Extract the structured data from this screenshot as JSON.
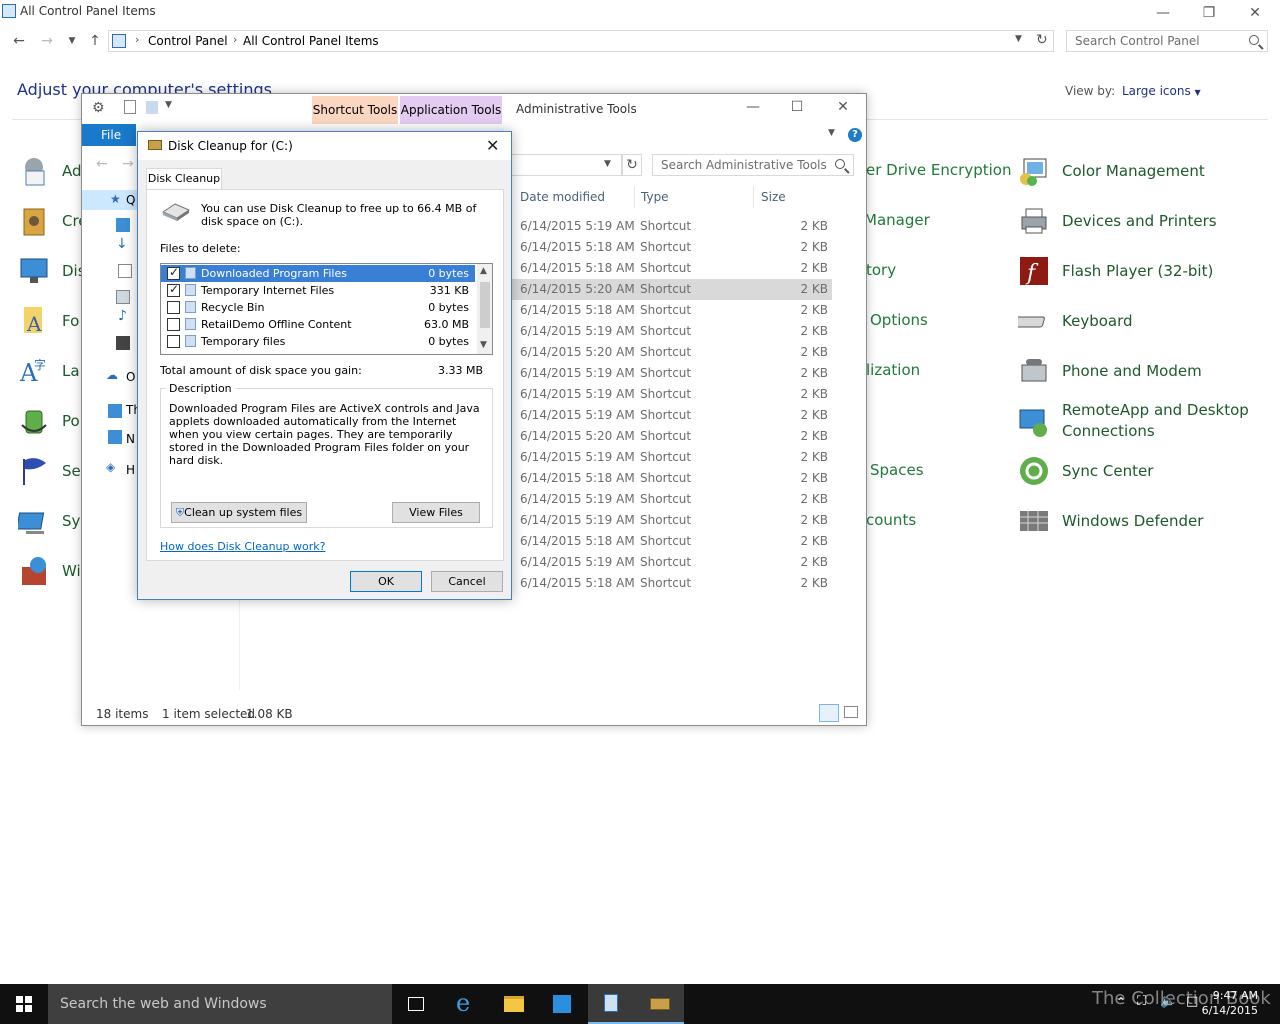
{
  "control_panel": {
    "window_title": "All Control Panel Items",
    "breadcrumb": [
      "Control Panel",
      "All Control Panel Items"
    ],
    "search_placeholder": "Search Control Panel",
    "heading": "Adjust your computer's settings",
    "view_by_label": "View by:",
    "view_by_value": "Large icons",
    "left_items": [
      "Ad",
      "Cre",
      "Dis",
      "Fo",
      "La",
      "Po",
      "Se",
      "Sys",
      "Wi"
    ],
    "middle_items": [
      "er Drive Encryption",
      "Manager",
      "tory",
      "Options",
      "lization",
      "Spaces",
      "counts"
    ],
    "right_items": [
      "Color Management",
      "Devices and Printers",
      "Flash Player (32-bit)",
      "Keyboard",
      "Phone and Modem",
      "RemoteApp and Desktop",
      "Connections",
      "Sync Center",
      "Windows Defender"
    ]
  },
  "admin_tools": {
    "tab_shortcut": "Shortcut Tools",
    "tab_application": "Application Tools",
    "title": "Administrative Tools",
    "file_tab": "File",
    "search_placeholder": "Search Administrative Tools",
    "columns": {
      "date": "Date modified",
      "type": "Type",
      "size": "Size"
    },
    "rows": [
      {
        "date": "6/14/2015 5:19 AM",
        "type": "Shortcut",
        "size": "2 KB"
      },
      {
        "date": "6/14/2015 5:18 AM",
        "type": "Shortcut",
        "size": "2 KB"
      },
      {
        "date": "6/14/2015 5:18 AM",
        "type": "Shortcut",
        "size": "2 KB"
      },
      {
        "date": "6/14/2015 5:20 AM",
        "type": "Shortcut",
        "size": "2 KB"
      },
      {
        "date": "6/14/2015 5:18 AM",
        "type": "Shortcut",
        "size": "2 KB"
      },
      {
        "date": "6/14/2015 5:19 AM",
        "type": "Shortcut",
        "size": "2 KB"
      },
      {
        "date": "6/14/2015 5:20 AM",
        "type": "Shortcut",
        "size": "2 KB"
      },
      {
        "date": "6/14/2015 5:19 AM",
        "type": "Shortcut",
        "size": "2 KB"
      },
      {
        "date": "6/14/2015 5:19 AM",
        "type": "Shortcut",
        "size": "2 KB"
      },
      {
        "date": "6/14/2015 5:19 AM",
        "type": "Shortcut",
        "size": "2 KB"
      },
      {
        "date": "6/14/2015 5:20 AM",
        "type": "Shortcut",
        "size": "2 KB"
      },
      {
        "date": "6/14/2015 5:19 AM",
        "type": "Shortcut",
        "size": "2 KB"
      },
      {
        "date": "6/14/2015 5:18 AM",
        "type": "Shortcut",
        "size": "2 KB"
      },
      {
        "date": "6/14/2015 5:19 AM",
        "type": "Shortcut",
        "size": "2 KB"
      },
      {
        "date": "6/14/2015 5:19 AM",
        "type": "Shortcut",
        "size": "2 KB"
      },
      {
        "date": "6/14/2015 5:18 AM",
        "type": "Shortcut",
        "size": "2 KB"
      },
      {
        "date": "6/14/2015 5:19 AM",
        "type": "Shortcut",
        "size": "2 KB"
      },
      {
        "date": "6/14/2015 5:18 AM",
        "type": "Shortcut",
        "size": "2 KB"
      }
    ],
    "nav_letters": [
      "Q",
      "Th",
      "N",
      "H"
    ],
    "status_count": "18 items",
    "status_selected": "1 item selected",
    "status_size": "1.08 KB",
    "nav_o": "O"
  },
  "disk_cleanup": {
    "title": "Disk Cleanup for  (C:)",
    "tab": "Disk Cleanup",
    "intro": "You can use Disk Cleanup to free up to 66.4 MB of disk space on  (C:).",
    "files_label": "Files to delete:",
    "files": [
      {
        "name": "Downloaded Program Files",
        "size": "0 bytes",
        "checked": true
      },
      {
        "name": "Temporary Internet Files",
        "size": "331 KB",
        "checked": true
      },
      {
        "name": "Recycle Bin",
        "size": "0 bytes",
        "checked": false
      },
      {
        "name": "RetailDemo Offline Content",
        "size": "63.0 MB",
        "checked": false
      },
      {
        "name": "Temporary files",
        "size": "0 bytes",
        "checked": false
      }
    ],
    "total_label": "Total amount of disk space you gain:",
    "total_value": "3.33 MB",
    "desc_legend": "Description",
    "desc_text": "Downloaded Program Files are ActiveX controls and Java applets downloaded automatically from the Internet when you view certain pages. They are temporarily stored in the Downloaded Program Files folder on your hard disk.",
    "btn_cleanup": "Clean up system files",
    "btn_view": "View Files",
    "link": "How does Disk Cleanup work?",
    "btn_ok": "OK",
    "btn_cancel": "Cancel"
  },
  "taskbar": {
    "search_placeholder": "Search the web and Windows",
    "time": "9:47 AM",
    "date": "6/14/2015",
    "watermark": "The Collection Book"
  }
}
